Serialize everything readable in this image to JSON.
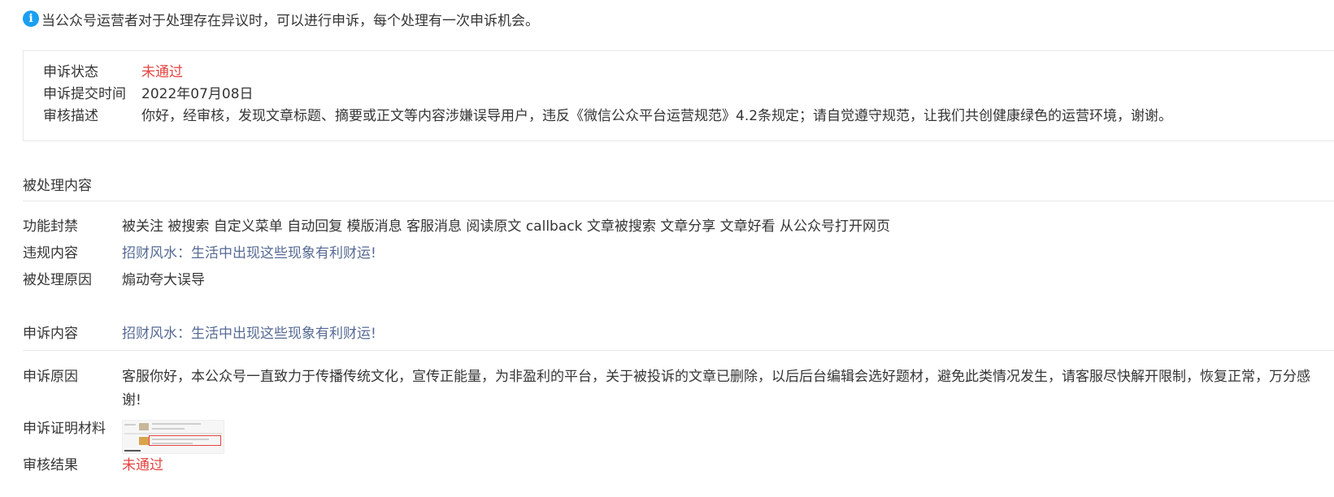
{
  "notice": {
    "icon": "info-icon",
    "text": "当公众号运营者对于处理存在异议时，可以进行申诉，每个处理有一次申诉机会。"
  },
  "appeal_status": {
    "status_label": "申诉状态",
    "status_value": "未通过",
    "submit_time_label": "申诉提交时间",
    "submit_time_value": "2022年07月08日",
    "review_desc_label": "审核描述",
    "review_desc_value": "你好，经审核，发现文章标题、摘要或正文等内容涉嫌误导用户，违反《微信公众平台运营规范》4.2条规定；请自觉遵守规范，让我们共创健康绿色的运营环境，谢谢。"
  },
  "handled": {
    "section_title": "被处理内容",
    "ban_label": "功能封禁",
    "ban_value": "被关注 被搜索 自定义菜单 自动回复 模版消息 客服消息 阅读原文 callback 文章被搜索 文章分享 文章好看 从公众号打开网页",
    "violation_label": "违规内容",
    "violation_value": "招财风水：生活中出现这些现象有利财运!",
    "reason_label": "被处理原因",
    "reason_value": "煽动夸大误导"
  },
  "appeal": {
    "content_label": "申诉内容",
    "content_value": "招财风水：生活中出现这些现象有利财运!",
    "reason_label": "申诉原因",
    "reason_value": "客服你好，本公众号一直致力于传播传统文化，宣传正能量，为非盈利的平台，关于被投诉的文章已删除，以后后台编辑会选好题材，避免此类情况发生，请客服尽快解开限制，恢复正常，万分感谢!",
    "evidence_label": "申诉证明材料",
    "result_label": "审核结果",
    "result_value": "未通过"
  },
  "colors": {
    "accent_red": "#e64340",
    "link_blue": "#576b95",
    "info_blue": "#1a9ff2"
  }
}
